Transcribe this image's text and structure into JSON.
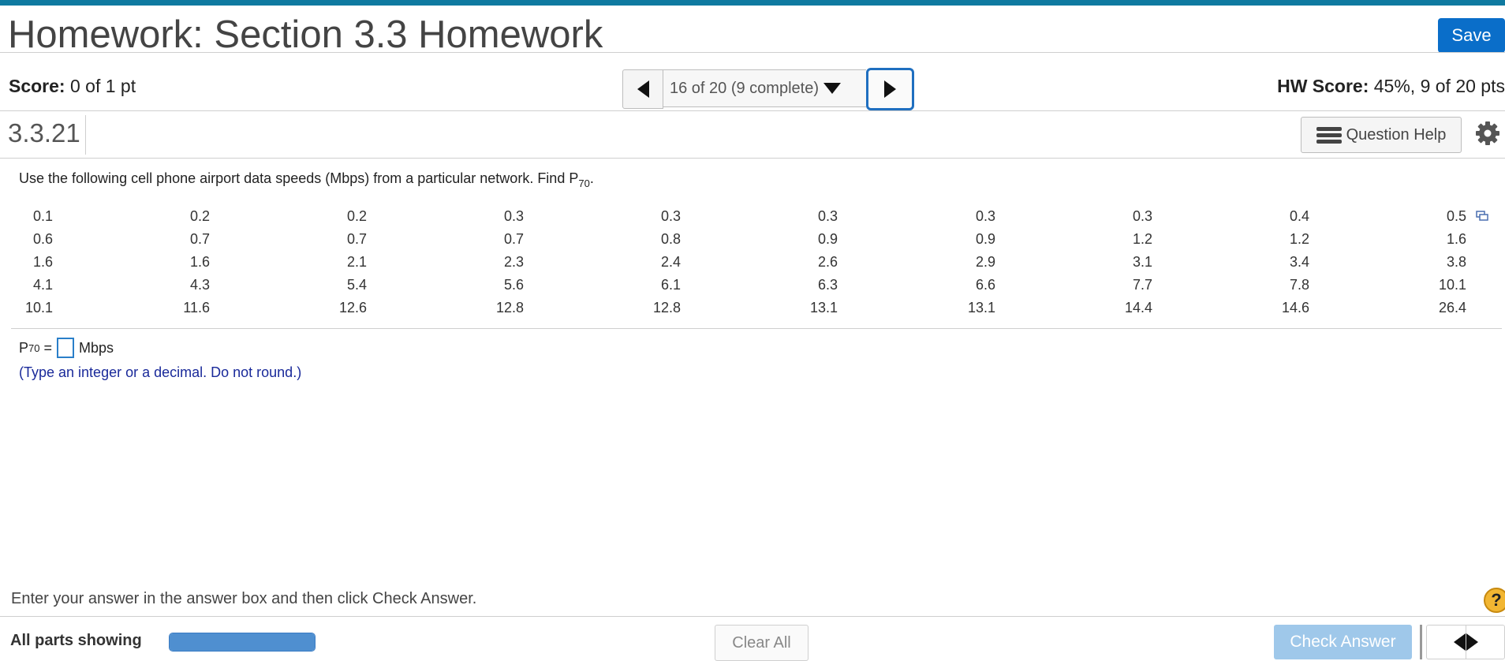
{
  "header": {
    "title": "Homework: Section 3.3 Homework",
    "save_label": "Save",
    "accent_color": "#0f7aa0"
  },
  "status": {
    "score_label": "Score:",
    "score_value": "0 of 1 pt",
    "hw_score_label": "HW Score:",
    "hw_score_value": "45%, 9 of 20 pts"
  },
  "navigator": {
    "position_text": "16 of 20 (9 complete)"
  },
  "question": {
    "number": "3.3.21",
    "help_label": "Question Help",
    "text_prefix": "Use the following cell phone airport data speeds (Mbps) from a particular network. Find P",
    "text_sub": "70",
    "text_suffix": ".",
    "data_rows": [
      [
        "0.1",
        "0.2",
        "0.2",
        "0.3",
        "0.3",
        "0.3",
        "0.3",
        "0.3",
        "0.4",
        "0.5"
      ],
      [
        "0.6",
        "0.7",
        "0.7",
        "0.7",
        "0.8",
        "0.9",
        "0.9",
        "1.2",
        "1.2",
        "1.6"
      ],
      [
        "1.6",
        "1.6",
        "2.1",
        "2.3",
        "2.4",
        "2.6",
        "2.9",
        "3.1",
        "3.4",
        "3.8"
      ],
      [
        "4.1",
        "4.3",
        "5.4",
        "5.6",
        "6.1",
        "6.3",
        "6.6",
        "7.7",
        "7.8",
        "10.1"
      ],
      [
        "10.1",
        "11.6",
        "12.6",
        "12.8",
        "12.8",
        "13.1",
        "13.1",
        "14.4",
        "14.6",
        "26.4"
      ]
    ],
    "answer_label": "P",
    "answer_sub": "70",
    "answer_equals": "=",
    "answer_value": "",
    "answer_unit": "Mbps",
    "hint": "(Type an integer or a decimal. Do not round.)"
  },
  "footer": {
    "instruction": "Enter your answer in the answer box and then click Check Answer.",
    "help_symbol": "?",
    "parts_label": "All parts showing",
    "progress_fraction": 1.0,
    "clear_label": "Clear All",
    "check_label": "Check Answer"
  }
}
